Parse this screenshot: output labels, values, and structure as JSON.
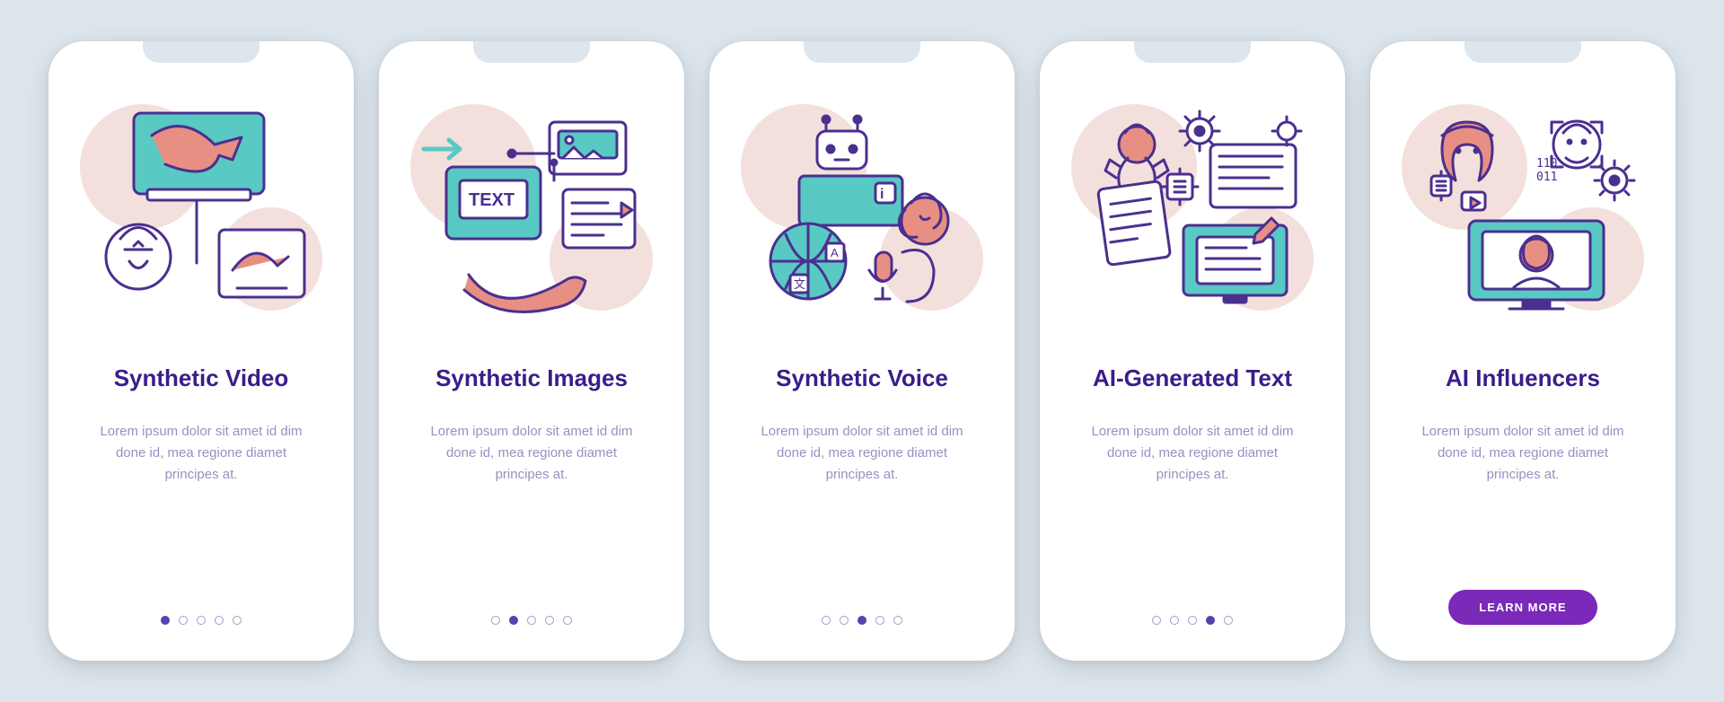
{
  "colors": {
    "background": "#dde6ed",
    "card": "#ffffff",
    "title": "#3a1d8a",
    "body": "#9a8fc0",
    "dot_active": "#5b3fb0",
    "dot_inactive_border": "#a59ac8",
    "cta_bg": "#7a29b8",
    "cta_text": "#ffffff",
    "illus_stroke": "#4b2f8f",
    "illus_fill_peach": "#f3e0dc",
    "illus_fill_salmon": "#e88f84",
    "illus_fill_teal": "#59c9c3"
  },
  "page_count": 5,
  "cta_label": "LEARN MORE",
  "cards": [
    {
      "title": "Synthetic Video",
      "body": "Lorem ipsum dolor sit amet id dim done id, mea regione diamet principes at.",
      "active_index": 0,
      "illustration": "synthetic-video"
    },
    {
      "title": "Synthetic Images",
      "body": "Lorem ipsum dolor sit amet id dim done id, mea regione diamet principes at.",
      "active_index": 1,
      "illustration": "synthetic-images"
    },
    {
      "title": "Synthetic Voice",
      "body": "Lorem ipsum dolor sit amet id dim done id, mea regione diamet principes at.",
      "active_index": 2,
      "illustration": "synthetic-voice"
    },
    {
      "title": "AI-Generated Text",
      "body": "Lorem ipsum dolor sit amet id dim done id, mea regione diamet principes at.",
      "active_index": 3,
      "illustration": "ai-generated-text"
    },
    {
      "title": "AI Influencers",
      "body": "Lorem ipsum dolor sit amet id dim done id, mea regione diamet principes at.",
      "active_index": 4,
      "illustration": "ai-influencers"
    }
  ]
}
